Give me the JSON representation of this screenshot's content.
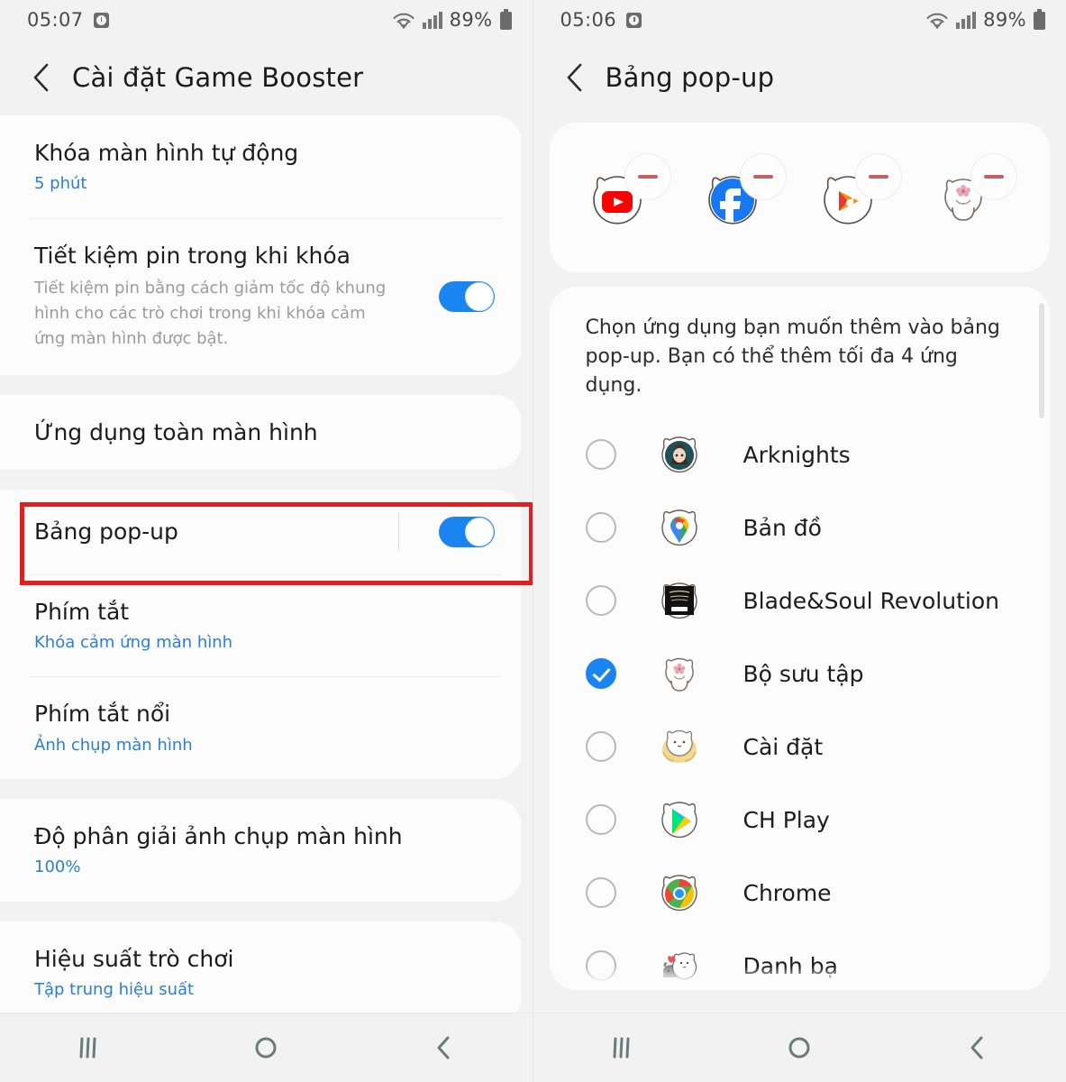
{
  "left_screen": {
    "status": {
      "time": "05:07",
      "alarm_icon": "alarm-clock-icon",
      "wifi_icon": "wifi-icon",
      "signal_icon": "cellular-signal-icon",
      "battery_percent": "89%",
      "battery_icon": "battery-icon"
    },
    "title": "Cài đặt Game Booster",
    "back_icon": "back-chevron-icon",
    "sections": [
      {
        "rows": [
          {
            "title": "Khóa màn hình tự động",
            "sub": "5 phút",
            "toggle": null
          },
          {
            "title": "Tiết kiệm pin trong khi khóa",
            "desc": "Tiết kiệm pin bằng cách giảm tốc độ khung hình cho các trò chơi trong khi khóa cảm ứng màn hình được bật.",
            "toggle": "on"
          }
        ]
      },
      {
        "rows": [
          {
            "title": "Ứng dụng toàn màn hình",
            "toggle": null
          }
        ]
      },
      {
        "highlighted": true,
        "rows": [
          {
            "title": "Bảng pop-up",
            "toggle": "on",
            "has_divider": true
          },
          {
            "title": "Phím tắt",
            "sub": "Khóa cảm ứng màn hình",
            "toggle": null
          },
          {
            "title": "Phím tắt nổi",
            "sub": "Ảnh chụp màn hình",
            "toggle": null
          }
        ]
      },
      {
        "rows": [
          {
            "title": "Độ phân giải ảnh chụp màn hình",
            "sub": "100%",
            "toggle": null
          }
        ]
      },
      {
        "rows": [
          {
            "title": "Hiệu suất trò chơi",
            "sub": "Tập trung hiệu suất",
            "toggle": null
          }
        ]
      }
    ],
    "navbar": {
      "recents_icon": "recents-icon",
      "home_icon": "home-icon",
      "back_icon": "back-chevron-icon"
    }
  },
  "right_screen": {
    "status": {
      "time": "05:06",
      "alarm_icon": "alarm-clock-icon",
      "wifi_icon": "wifi-icon",
      "signal_icon": "cellular-signal-icon",
      "battery_percent": "89%",
      "battery_icon": "battery-icon"
    },
    "title": "Bảng pop-up",
    "back_icon": "back-chevron-icon",
    "selected_chips": [
      {
        "name": "YouTube",
        "icon": "youtube-icon",
        "remove_icon": "minus-icon"
      },
      {
        "name": "Facebook",
        "icon": "facebook-icon",
        "remove_icon": "minus-icon"
      },
      {
        "name": "Google Play Music",
        "icon": "google-play-music-icon",
        "remove_icon": "minus-icon"
      },
      {
        "name": "Bộ sưu tập",
        "icon": "gallery-cat-icon",
        "remove_icon": "minus-icon"
      }
    ],
    "intro": "Chọn ứng dụng bạn muốn thêm vào bảng pop-up. Bạn có thể thêm tối đa 4 ứng dụng.",
    "apps": [
      {
        "name": "Arknights",
        "icon": "arknights-icon",
        "checked": false
      },
      {
        "name": "Bản đồ",
        "icon": "maps-icon",
        "checked": false
      },
      {
        "name": "Blade&Soul Revolution",
        "icon": "bladesoul-icon",
        "checked": false
      },
      {
        "name": "Bộ sưu tập",
        "icon": "gallery-cat-icon",
        "checked": true
      },
      {
        "name": "Cài đặt",
        "icon": "settings-cat-icon",
        "checked": false
      },
      {
        "name": "CH Play",
        "icon": "play-store-icon",
        "checked": false
      },
      {
        "name": "Chrome",
        "icon": "chrome-icon",
        "checked": false
      },
      {
        "name": "Danh bạ",
        "icon": "contacts-cat-icon",
        "checked": false
      }
    ],
    "scrollbar": "vertical-scrollbar",
    "navbar": {
      "recents_icon": "recents-icon",
      "home_icon": "home-icon",
      "back_icon": "back-chevron-icon"
    }
  },
  "colors": {
    "accent_blue": "#1a84f0",
    "link_blue": "#2a7fd4",
    "highlight_red": "#e02020",
    "page_bg": "#f2f2f2",
    "card_bg": "#fcfcfc"
  }
}
